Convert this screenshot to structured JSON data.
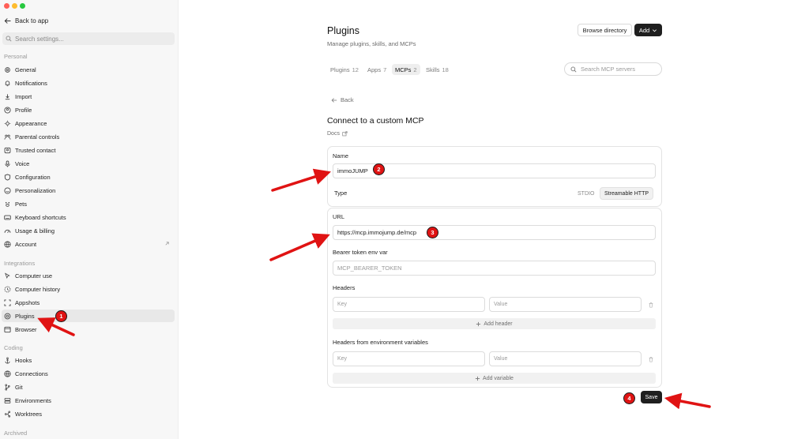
{
  "sidebar": {
    "back_label": "Back to app",
    "search_placeholder": "Search settings...",
    "sections": {
      "personal": "Personal",
      "integrations": "Integrations",
      "coding": "Coding",
      "archived": "Archived"
    },
    "personal_items": [
      "General",
      "Notifications",
      "Import",
      "Profile",
      "Appearance",
      "Parental controls",
      "Trusted contact",
      "Voice",
      "Configuration",
      "Personalization",
      "Pets",
      "Keyboard shortcuts",
      "Usage & billing",
      "Account"
    ],
    "integration_items": [
      "Computer use",
      "Computer history",
      "Appshots",
      "Plugins",
      "Browser"
    ],
    "coding_items": [
      "Hooks",
      "Connections",
      "Git",
      "Environments",
      "Worktrees"
    ],
    "active_item": "Plugins"
  },
  "header": {
    "title": "Plugins",
    "subtitle": "Manage plugins, skills, and MCPs",
    "browse_button": "Browse directory",
    "add_button": "Add"
  },
  "tabs": [
    {
      "label": "Plugins",
      "count": "12"
    },
    {
      "label": "Apps",
      "count": "7"
    },
    {
      "label": "MCPs",
      "count": "2"
    },
    {
      "label": "Skills",
      "count": "18"
    }
  ],
  "active_tab": "MCPs",
  "search_mcp_placeholder": "Search MCP servers",
  "form": {
    "back": "Back",
    "title": "Connect to a custom MCP",
    "docs": "Docs",
    "name_label": "Name",
    "name_value": "immoJUMP",
    "type_label": "Type",
    "type_options": [
      "STDIO",
      "Streamable HTTP"
    ],
    "type_selected": "Streamable HTTP",
    "url_label": "URL",
    "url_value": "https://mcp.immojump.de/mcp",
    "bearer_label": "Bearer token env var",
    "bearer_placeholder": "MCP_BEARER_TOKEN",
    "headers_label": "Headers",
    "key_placeholder": "Key",
    "value_placeholder": "Value",
    "add_header": "Add header",
    "env_headers_label": "Headers from environment variables",
    "add_variable": "Add variable",
    "save": "Save"
  },
  "annotations": [
    "1",
    "2",
    "3",
    "4"
  ],
  "colors": {
    "annotation_red": "#e01313",
    "dark_button": "#1f1f1f",
    "sidebar_bg": "#f7f7f7"
  }
}
